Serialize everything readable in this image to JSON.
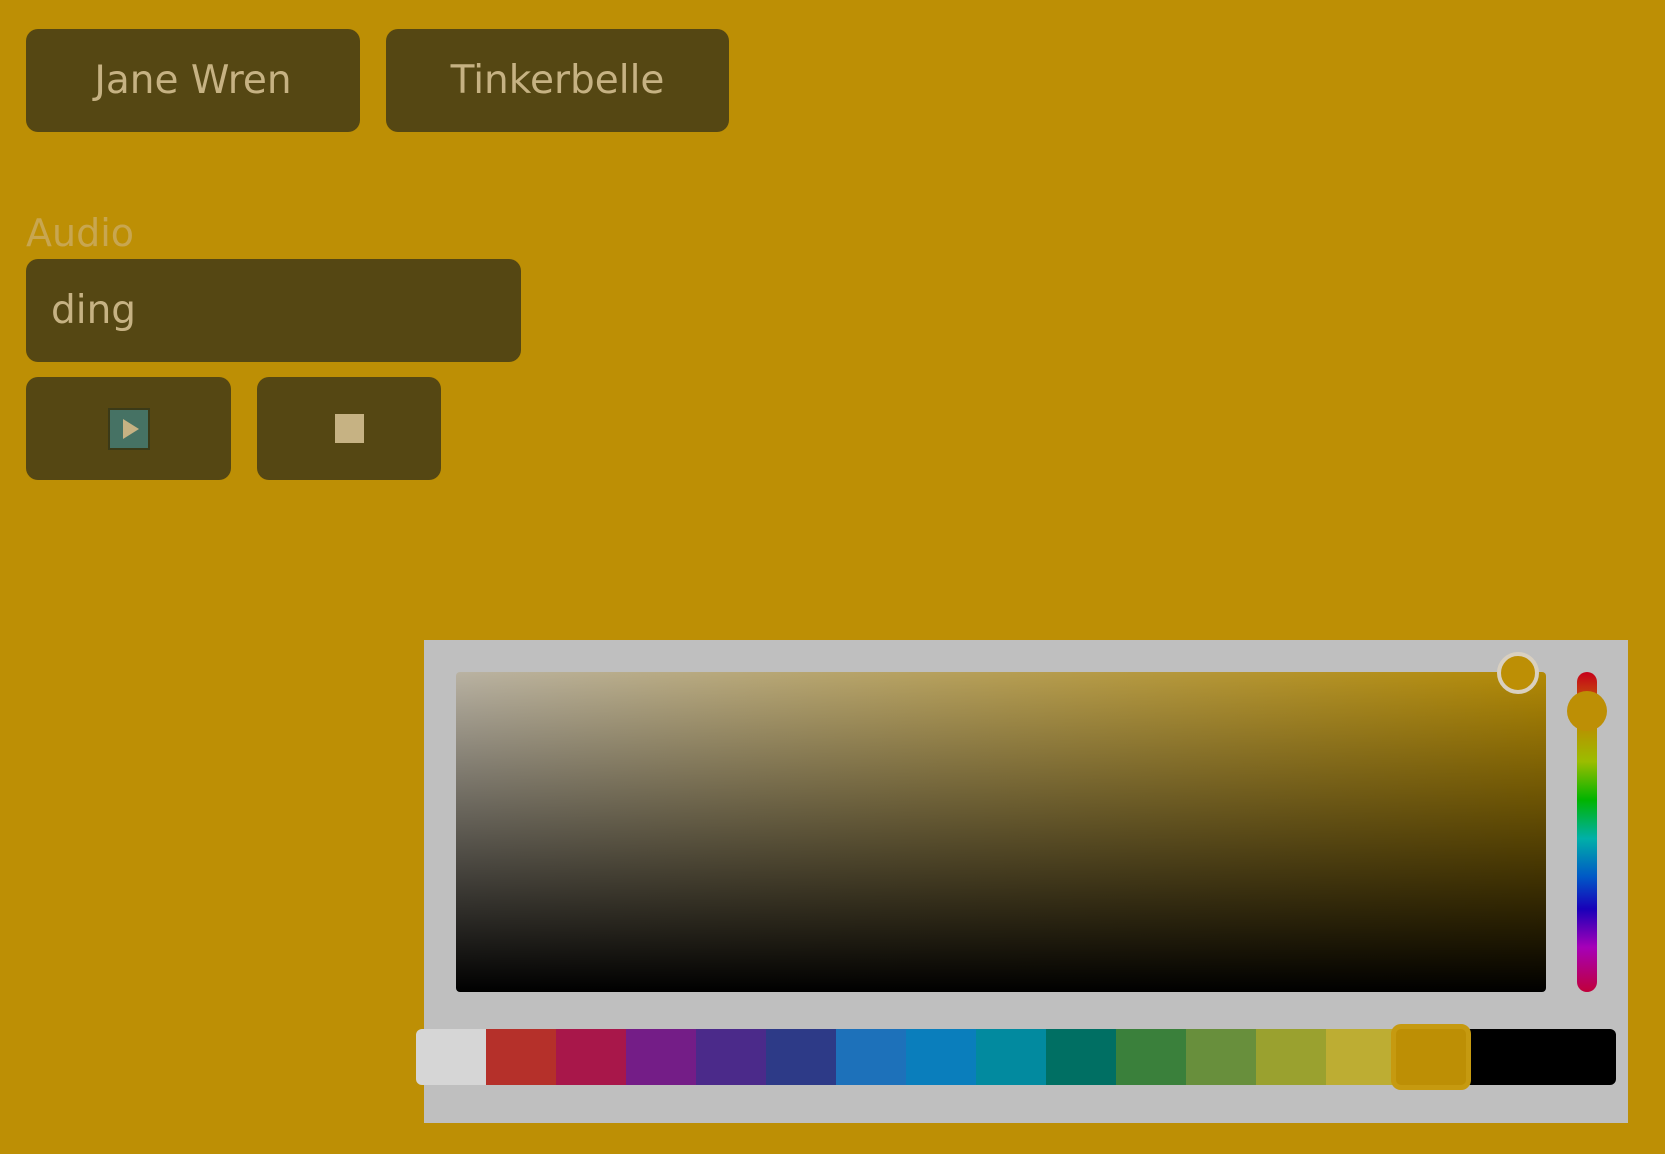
{
  "buttons": {
    "jane_wren": "Jane Wren",
    "tinkerbelle": "Tinkerbelle"
  },
  "audio": {
    "label": "Audio",
    "value": "ding",
    "play_icon": "play-icon",
    "stop_icon": "stop-icon"
  },
  "color_picker": {
    "selected_color": "#bd8f05",
    "swatches": [
      {
        "name": "white",
        "color": "#d6d6d6"
      },
      {
        "name": "red",
        "color": "#b5302a"
      },
      {
        "name": "crimson",
        "color": "#a8174a"
      },
      {
        "name": "purple",
        "color": "#741d87"
      },
      {
        "name": "deep-purple",
        "color": "#4b2a8a"
      },
      {
        "name": "indigo",
        "color": "#2d3a87"
      },
      {
        "name": "blue",
        "color": "#1d71ba"
      },
      {
        "name": "light-blue",
        "color": "#0a7ebc"
      },
      {
        "name": "cyan",
        "color": "#028a9f"
      },
      {
        "name": "teal",
        "color": "#006f63"
      },
      {
        "name": "green",
        "color": "#3a803b"
      },
      {
        "name": "light-green",
        "color": "#688f3c"
      },
      {
        "name": "lime",
        "color": "#9aa12f"
      },
      {
        "name": "yellow",
        "color": "#bdad33"
      },
      {
        "name": "amber",
        "color": "#bd8f05"
      },
      {
        "name": "black",
        "color": "#000000"
      }
    ]
  }
}
